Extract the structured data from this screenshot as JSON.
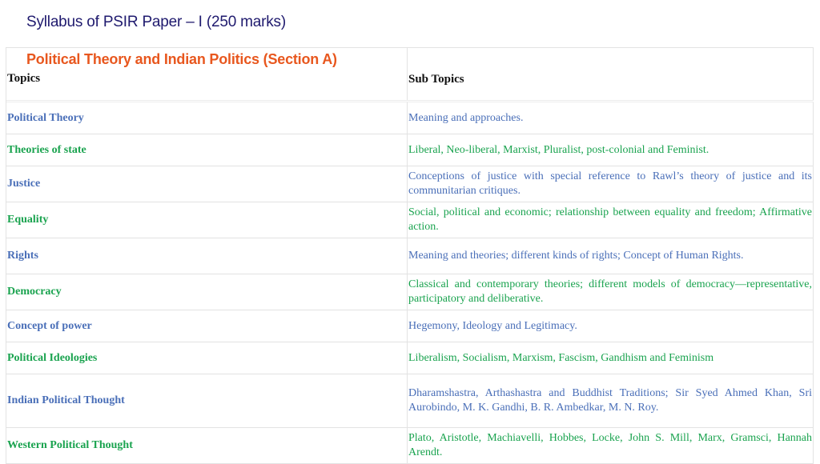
{
  "page": {
    "title": "Syllabus of PSIR Paper – I (250 marks)",
    "section": "Political Theory and Indian Politics (Section A)"
  },
  "table": {
    "headers": [
      "Topics",
      "Sub Topics"
    ],
    "rows": [
      {
        "topic": "Political Theory",
        "subtopic": "Meaning and approaches.",
        "color": "#4a6fb8"
      },
      {
        "topic": "Theories of state",
        "subtopic": "Liberal, Neo-liberal, Marxist, Pluralist, post-colonial and Feminist.",
        "color": "#1aa34f"
      },
      {
        "topic": "Justice",
        "subtopic": "Conceptions of justice with special reference to Rawl’s theory of justice and its communitarian critiques.",
        "color": "#4a6fb8"
      },
      {
        "topic": "Equality",
        "subtopic": "Social, political and economic; relationship between equality and freedom; Affirmative action.",
        "color": "#1aa34f"
      },
      {
        "topic": "Rights",
        "subtopic": "Meaning and theories; different kinds of rights; Concept of Human Rights.",
        "color": "#4a6fb8"
      },
      {
        "topic": "Democracy",
        "subtopic": "Classical and contemporary theories; different models of democracy—representative, participatory and deliberative.",
        "color": "#1aa34f"
      },
      {
        "topic": "Concept of power",
        "subtopic": "Hegemony, Ideology and Legitimacy.",
        "color": "#4a6fb8"
      },
      {
        "topic": "Political Ideologies",
        "subtopic": "Liberalism, Socialism, Marxism, Fascism, Gandhism and Feminism",
        "color": "#1aa34f"
      },
      {
        "topic": "Indian Political Thought",
        "subtopic": "Dharamshastra, Arthashastra and Buddhist Traditions; Sir Syed Ahmed Khan, Sri Aurobindo, M. K. Gandhi, B. R. Ambedkar, M. N. Roy.",
        "color": "#4a6fb8"
      },
      {
        "topic": "Western Political Thought",
        "subtopic": "Plato, Aristotle, Machiavelli, Hobbes, Locke, John S. Mill, Marx, Gramsci, Hannah Arendt.",
        "color": "#1aa34f"
      }
    ]
  }
}
